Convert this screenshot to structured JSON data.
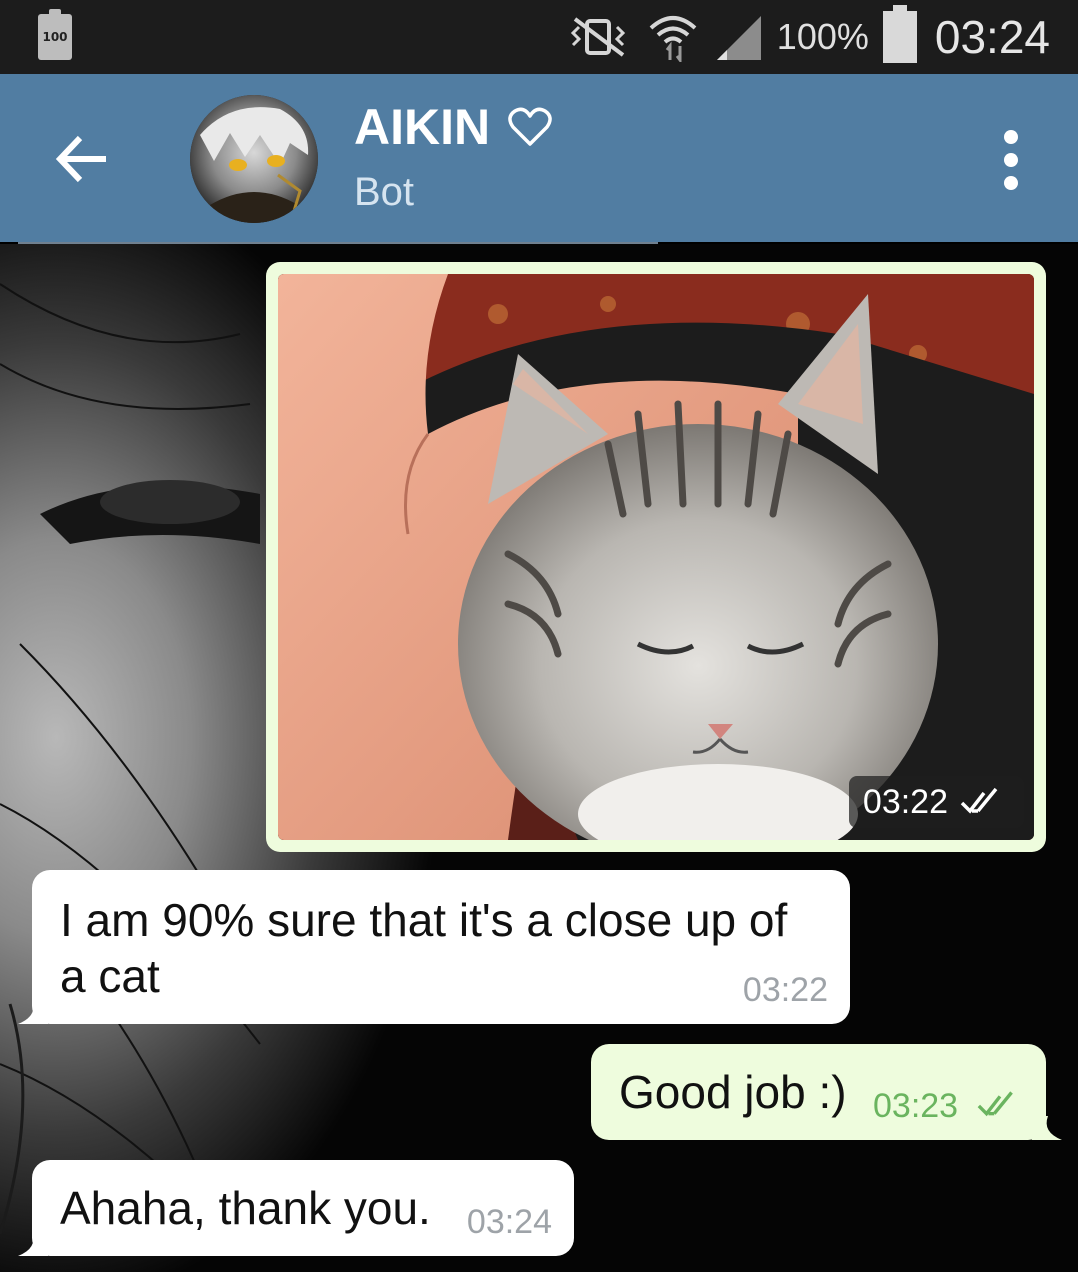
{
  "status_bar": {
    "battery_small_label": "100",
    "battery_percent": "100%",
    "time": "03:24"
  },
  "header": {
    "title": "AIKIN",
    "subtitle": "Bot",
    "icons": [
      "back-arrow-icon",
      "heart-icon",
      "overflow-menu-icon"
    ]
  },
  "messages": [
    {
      "type": "photo",
      "direction": "out",
      "time": "03:22",
      "status": "read"
    },
    {
      "type": "text",
      "direction": "in",
      "line1": "I am 90% sure that it's a close up of",
      "line2": "a cat",
      "time": "03:22"
    },
    {
      "type": "text",
      "direction": "out",
      "text": "Good job :)",
      "time": "03:23",
      "status": "read"
    },
    {
      "type": "text",
      "direction": "in",
      "text": "Ahaha, thank you.",
      "time": "03:24"
    }
  ],
  "colors": {
    "header": "#517da2",
    "status_bar": "#1c1c1c",
    "outgoing_bubble": "#eefcdd",
    "incoming_bubble": "#ffffff",
    "check_green": "#6ab45f"
  }
}
